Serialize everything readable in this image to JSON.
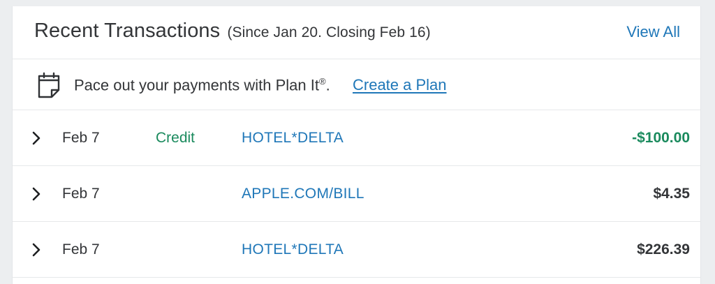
{
  "header": {
    "title": "Recent Transactions",
    "subtitle": "(Since Jan 20. Closing Feb 16)",
    "view_all_label": "View All"
  },
  "promo": {
    "icon": "calendar-note-icon",
    "text": "Pace out your payments with Plan It",
    "registered_mark": "®",
    "period": ".",
    "link_label": "Create a Plan"
  },
  "transactions": [
    {
      "date": "Feb 7",
      "type": "Credit",
      "merchant": "HOTEL*DELTA",
      "amount": "-$100.00",
      "is_credit": true
    },
    {
      "date": "Feb 7",
      "type": "",
      "merchant": "APPLE.COM/BILL",
      "amount": "$4.35",
      "is_credit": false
    },
    {
      "date": "Feb 7",
      "type": "",
      "merchant": "HOTEL*DELTA",
      "amount": "$226.39",
      "is_credit": false
    }
  ],
  "colors": {
    "link_blue": "#1f77b8",
    "credit_green": "#1a8a5d",
    "text_dark": "#333538"
  }
}
